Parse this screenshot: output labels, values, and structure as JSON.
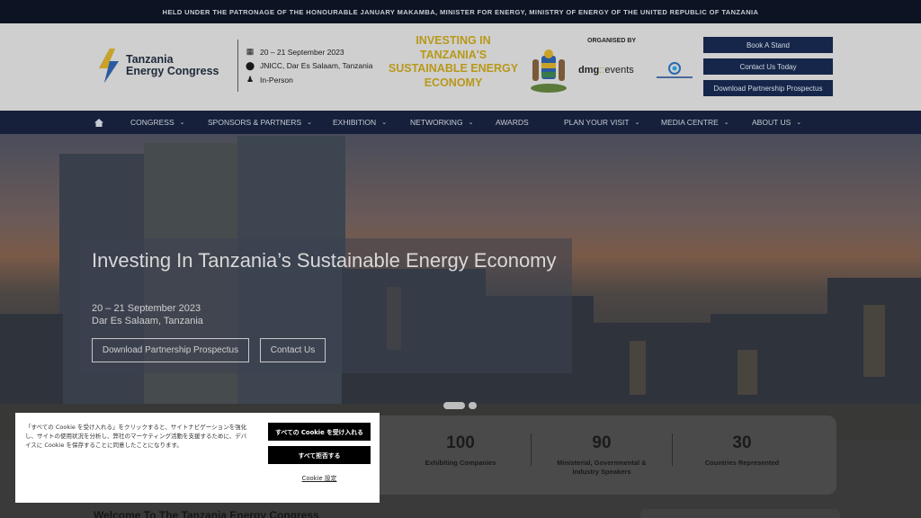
{
  "topbar": {
    "text": "HELD UNDER THE PATRONAGE OF THE HONOURABLE JANUARY MAKAMBA, MINISTER FOR ENERGY, MINISTRY OF ENERGY OF THE UNITED REPUBLIC OF TANZANIA"
  },
  "header": {
    "logo_line1": "Tanzania",
    "logo_line2": "Energy Congress",
    "event_date": "20 – 21 September 2023",
    "event_venue": "JNICC, Dar Es Salaam, Tanzania",
    "event_mode": "In-Person",
    "tagline": "INVESTING IN TANZANIA'S SUSTAINABLE ENERGY ECONOMY",
    "organised_by": "ORGANISED BY",
    "organiser_main": "dmg",
    "organiser_events": "events",
    "buttons": [
      "Book A Stand",
      "Contact Us Today",
      "Download Partnership Prospectus"
    ],
    "accent": "#b8981a"
  },
  "nav": {
    "home_icon": "home-icon",
    "items": [
      "CONGRESS",
      "SPONSORS & PARTNERS",
      "EXHIBITION",
      "NETWORKING",
      "AWARDS",
      "PLAN YOUR VISIT",
      "MEDIA CENTRE",
      "ABOUT US"
    ]
  },
  "hero": {
    "title": "Investing In Tanzania’s Sustainable Energy Economy",
    "date": "20 – 21 September 2023",
    "location": "Dar Es Salaam, Tanzania",
    "btn_prospectus": "Download Partnership Prospectus",
    "btn_contact": "Contact Us"
  },
  "stats": [
    {
      "num": "100",
      "label": "Exhibiting Companies"
    },
    {
      "num": "90",
      "label": "Ministerial, Governmental & Industry Speakers"
    },
    {
      "num": "30",
      "label": "Countries Represented"
    }
  ],
  "welcome": {
    "title": "Welcome To The Tanzania Energy Congress"
  },
  "cookie": {
    "text": "「すべての Cookie を受け入れる」をクリックすると、サイトナビゲーションを強化し、サイトの使用状況を分析し、弊社のマーケティング活動を支援するために、デバイスに Cookie を保存することに同意したことになります。",
    "accept_all": "すべての Cookie を受け入れる",
    "reject_all": "すべて拒否する",
    "settings": "Cookie 設定"
  }
}
